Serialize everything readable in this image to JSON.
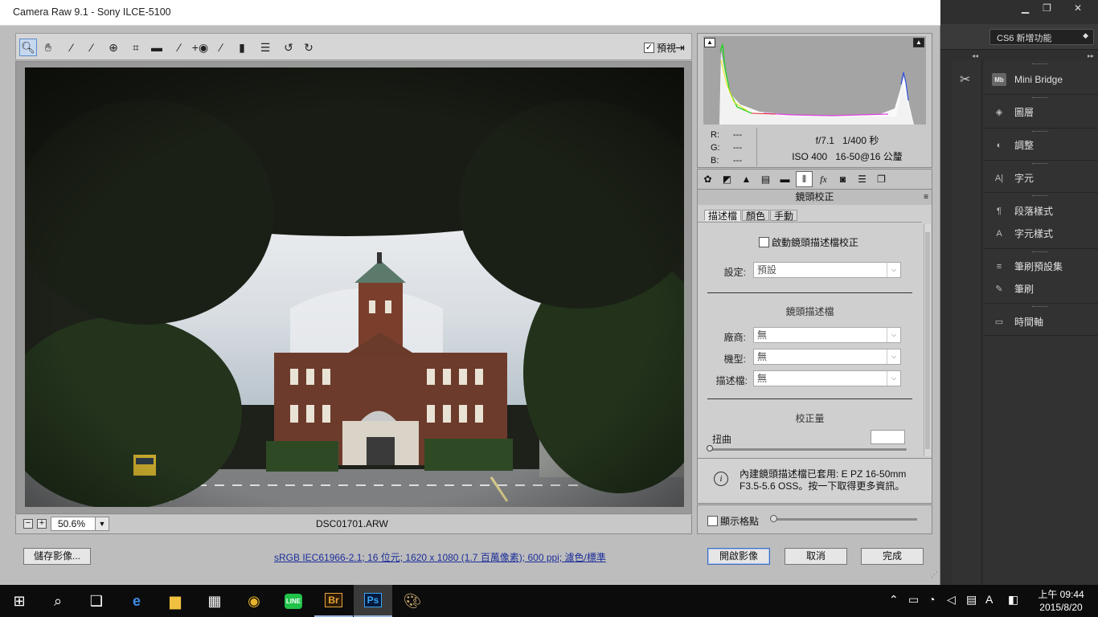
{
  "window": {
    "title": "Camera Raw 9.1  -  Sony ILCE-5100"
  },
  "toolbar": {
    "tools": [
      "zoom-icon",
      "hand-icon",
      "white-balance-icon",
      "color-sampler-icon",
      "targeted-adjustment-icon",
      "crop-icon",
      "straighten-icon",
      "spot-removal-icon",
      "red-eye-icon",
      "adjustment-brush-icon",
      "graduated-filter-icon",
      "preferences-icon",
      "rotate-left-icon",
      "rotate-right-icon"
    ],
    "preview_label": "預視",
    "preview_checked": true
  },
  "status": {
    "zoom": "50.6%",
    "filename": "DSC01701.ARW"
  },
  "readout": {
    "r_label": "R:",
    "g_label": "G:",
    "b_label": "B:",
    "r": "---",
    "g": "---",
    "b": "---"
  },
  "exif": {
    "aperture": "f/7.1",
    "shutter": "1/400 秒",
    "iso": "ISO 400",
    "lens": "16-50@16 公釐"
  },
  "panel": {
    "title": "鏡頭校正",
    "tabs": [
      "basic-icon",
      "tone-curve-icon",
      "detail-icon",
      "hsl-icon",
      "split-toning-icon",
      "lens-corrections-icon",
      "effects-icon",
      "camera-calibration-icon",
      "presets-icon",
      "snapshots-icon"
    ],
    "subtabs": [
      "描述檔",
      "顏色",
      "手動"
    ],
    "enable_label": "啟動鏡頭描述檔校正",
    "setting_label": "設定:",
    "setting_value": "預設",
    "profile_title": "鏡頭描述檔",
    "make_label": "廠商:",
    "make_value": "無",
    "model_label": "機型:",
    "model_value": "無",
    "profile_label": "描述檔:",
    "profile_value": "無",
    "amount_title": "校正量",
    "distortion_label": "扭曲",
    "info_text": "內建鏡頭描述檔已套用: E PZ 16-50mm F3.5-5.6 OSS。按一下取得更多資訊。",
    "grid_label": "顯示格點"
  },
  "buttons": {
    "save": "儲存影像...",
    "open": "開啟影像",
    "cancel": "取消",
    "done": "完成"
  },
  "workflow_options": "sRGB IEC61966-2.1; 16 位元; 1620 x 1080 (1.7 百萬像素); 600 ppi; 濾色/標準",
  "photoshop": {
    "workspace": "CS6 新增功能",
    "panels": [
      "Mini Bridge",
      "圖層",
      "調整",
      "字元",
      "段落樣式",
      "字元樣式",
      "筆刷預設集",
      "筆刷",
      "時間軸"
    ]
  },
  "taskbar": {
    "apps": [
      "start-icon",
      "search-icon",
      "task-view-icon",
      "edge-icon",
      "file-explorer-icon",
      "store-icon",
      "chrome-icon",
      "line-icon",
      "bridge-icon",
      "photoshop-icon",
      "paint-icon"
    ],
    "bridge_label": "Br",
    "ps_label": "Ps",
    "line_label": "LINE",
    "ime": "A",
    "time": "上午 09:44",
    "date": "2015/8/20"
  },
  "colors": {
    "accent": "#5c8bc8",
    "link": "#1c2e9a",
    "ps_dark": "#2f2f2f"
  }
}
